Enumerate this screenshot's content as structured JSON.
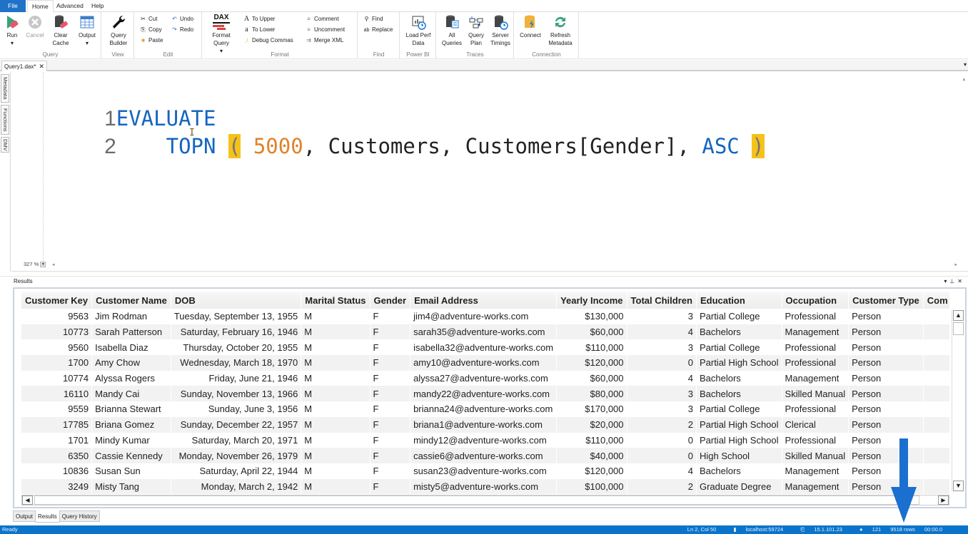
{
  "menu": {
    "file": "File",
    "tabs": [
      "Home",
      "Advanced",
      "Help"
    ]
  },
  "ribbon": {
    "query_group": {
      "label": "Query",
      "run": "Run",
      "cancel": "Cancel",
      "clear_cache": "Clear Cache",
      "output": "Output"
    },
    "view_group": {
      "label": "View",
      "query_builder": "Query Builder"
    },
    "edit_group": {
      "label": "Edit",
      "cut": "Cut",
      "copy": "Copy",
      "paste": "Paste",
      "undo": "Undo",
      "redo": "Redo"
    },
    "format_group": {
      "label": "Format",
      "format_query": "Format Query",
      "dax_badge": "DAX",
      "to_upper": "To Upper",
      "to_lower": "To Lower",
      "debug_commas": "Debug Commas",
      "comment": "Comment",
      "uncomment": "Uncomment",
      "merge_xml": "Merge XML"
    },
    "find_group": {
      "label": "Find",
      "find": "Find",
      "replace": "Replace"
    },
    "powerbi_group": {
      "label": "Power BI",
      "load_perf_data": "Load Perf Data"
    },
    "traces_group": {
      "label": "Traces",
      "all_queries": "All Queries",
      "query_plan": "Query Plan",
      "server_timings": "Server Timings"
    },
    "connection_group": {
      "label": "Connection",
      "connect": "Connect",
      "refresh_metadata": "Refresh Metadata"
    }
  },
  "document_tab": {
    "label": "Query1.dax*",
    "close": "✕"
  },
  "side_tabs": [
    "Metadata",
    "Functions",
    "DMV"
  ],
  "editor": {
    "lines": [
      {
        "number": "1",
        "tokens": [
          {
            "text": "EVALUATE",
            "type": "kw"
          }
        ]
      },
      {
        "number": "2",
        "tokens": [
          {
            "text": "    TOPN ",
            "type": "kw"
          },
          {
            "text": "(",
            "type": "paren"
          },
          {
            "text": " ",
            "type": "id"
          },
          {
            "text": "5000",
            "type": "num"
          },
          {
            "text": ", Customers, Customers[Gender], ",
            "type": "id"
          },
          {
            "text": "ASC",
            "type": "kw"
          },
          {
            "text": " ",
            "type": "id"
          },
          {
            "text": ")",
            "type": "paren"
          }
        ]
      }
    ],
    "zoom": "327 %"
  },
  "results": {
    "title": "Results",
    "columns": [
      "Customer Key",
      "Customer Name",
      "DOB",
      "Marital Status",
      "Gender",
      "Email Address",
      "Yearly Income",
      "Total Children",
      "Education",
      "Occupation",
      "Customer Type",
      "Com"
    ],
    "rows": [
      [
        "9563",
        "Jim Rodman",
        "Tuesday, September 13, 1955",
        "M",
        "F",
        "jim4@adventure-works.com",
        "$130,000",
        "3",
        "Partial College",
        "Professional",
        "Person",
        ""
      ],
      [
        "10773",
        "Sarah Patterson",
        "Saturday, February 16, 1946",
        "M",
        "F",
        "sarah35@adventure-works.com",
        "$60,000",
        "4",
        "Bachelors",
        "Management",
        "Person",
        ""
      ],
      [
        "9560",
        "Isabella Diaz",
        "Thursday, October 20, 1955",
        "M",
        "F",
        "isabella32@adventure-works.com",
        "$110,000",
        "3",
        "Partial College",
        "Professional",
        "Person",
        ""
      ],
      [
        "1700",
        "Amy Chow",
        "Wednesday, March 18, 1970",
        "M",
        "F",
        "amy10@adventure-works.com",
        "$120,000",
        "0",
        "Partial High School",
        "Professional",
        "Person",
        ""
      ],
      [
        "10774",
        "Alyssa Rogers",
        "Friday, June 21, 1946",
        "M",
        "F",
        "alyssa27@adventure-works.com",
        "$60,000",
        "4",
        "Bachelors",
        "Management",
        "Person",
        ""
      ],
      [
        "16110",
        "Mandy Cai",
        "Sunday, November 13, 1966",
        "M",
        "F",
        "mandy22@adventure-works.com",
        "$80,000",
        "3",
        "Bachelors",
        "Skilled Manual",
        "Person",
        ""
      ],
      [
        "9559",
        "Brianna Stewart",
        "Sunday, June 3, 1956",
        "M",
        "F",
        "brianna24@adventure-works.com",
        "$170,000",
        "3",
        "Partial College",
        "Professional",
        "Person",
        ""
      ],
      [
        "17785",
        "Briana Gomez",
        "Sunday, December 22, 1957",
        "M",
        "F",
        "briana1@adventure-works.com",
        "$20,000",
        "2",
        "Partial High School",
        "Clerical",
        "Person",
        ""
      ],
      [
        "1701",
        "Mindy Kumar",
        "Saturday, March 20, 1971",
        "M",
        "F",
        "mindy12@adventure-works.com",
        "$110,000",
        "0",
        "Partial High School",
        "Professional",
        "Person",
        ""
      ],
      [
        "6350",
        "Cassie Kennedy",
        "Monday, November 26, 1979",
        "M",
        "F",
        "cassie6@adventure-works.com",
        "$40,000",
        "0",
        "High School",
        "Skilled Manual",
        "Person",
        ""
      ],
      [
        "10836",
        "Susan Sun",
        "Saturday, April 22, 1944",
        "M",
        "F",
        "susan23@adventure-works.com",
        "$120,000",
        "4",
        "Bachelors",
        "Management",
        "Person",
        ""
      ],
      [
        "3249",
        "Misty Tang",
        "Monday, March 2, 1942",
        "M",
        "F",
        "misty5@adventure-works.com",
        "$100,000",
        "2",
        "Graduate Degree",
        "Management",
        "Person",
        ""
      ]
    ]
  },
  "bottom_tabs": [
    "Output",
    "Results",
    "Query History"
  ],
  "active_bottom_tab": "Results",
  "status": {
    "left": "Ready",
    "position": "Ln 2, Col 50",
    "server": "localhost:59724",
    "version": "15.1.101.23",
    "spid": "121",
    "rows": "9518 rows",
    "duration": "00:00.0"
  },
  "colors": {
    "accent": "#0a74cc",
    "keyword": "#1565c0",
    "number": "#e0822a",
    "brace_highlight": "#f5c21b",
    "annotation_arrow": "#1a6fcf"
  }
}
